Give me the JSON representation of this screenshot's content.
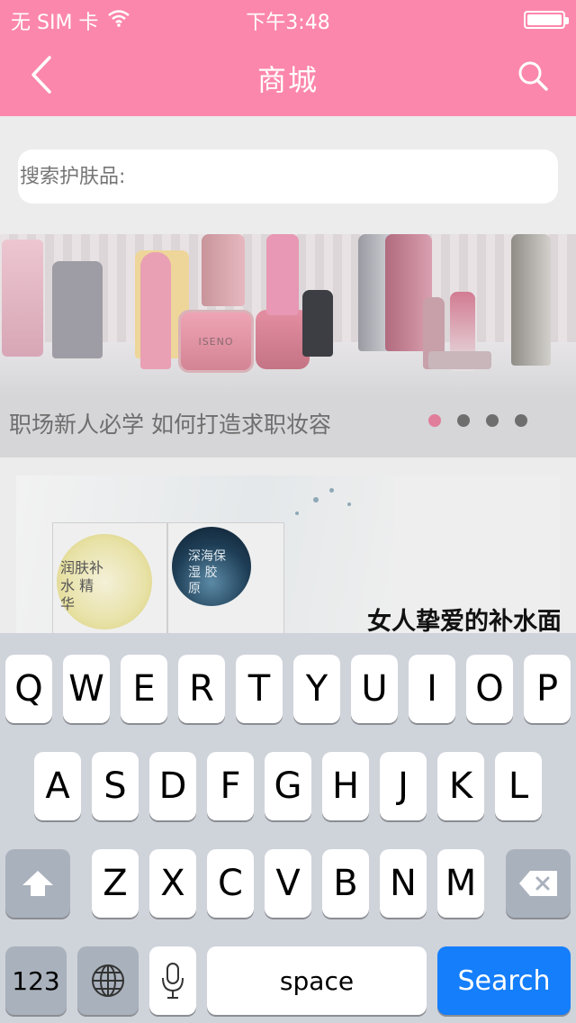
{
  "status_bar": {
    "carrier": "无 SIM 卡",
    "time": "下午3:48",
    "battery_level": 1.0
  },
  "nav": {
    "title": "商城",
    "back_icon": "chevron-left-icon",
    "search_icon": "search-icon"
  },
  "search": {
    "placeholder": "搜索护肤品:"
  },
  "banner": {
    "caption": "职场新人必学 如何打造求职妆容",
    "dot_count": 4,
    "active_dot": 0,
    "brand_text": "ISENO"
  },
  "product_card": {
    "title": "女人挚爱的补水面",
    "mask_text_1": "润肤补水 精华",
    "mask_text_2": "深海保湿 胶原"
  },
  "keyboard": {
    "row1": [
      "Q",
      "W",
      "E",
      "R",
      "T",
      "Y",
      "U",
      "I",
      "O",
      "P"
    ],
    "row2": [
      "A",
      "S",
      "D",
      "F",
      "G",
      "H",
      "J",
      "K",
      "L"
    ],
    "row3": [
      "Z",
      "X",
      "C",
      "V",
      "B",
      "N",
      "M"
    ],
    "numbers_label": "123",
    "space_label": "space",
    "search_label": "Search"
  },
  "colors": {
    "header": "#fc87ac",
    "active_dot": "#e07d9a",
    "search_key": "#147efb"
  }
}
